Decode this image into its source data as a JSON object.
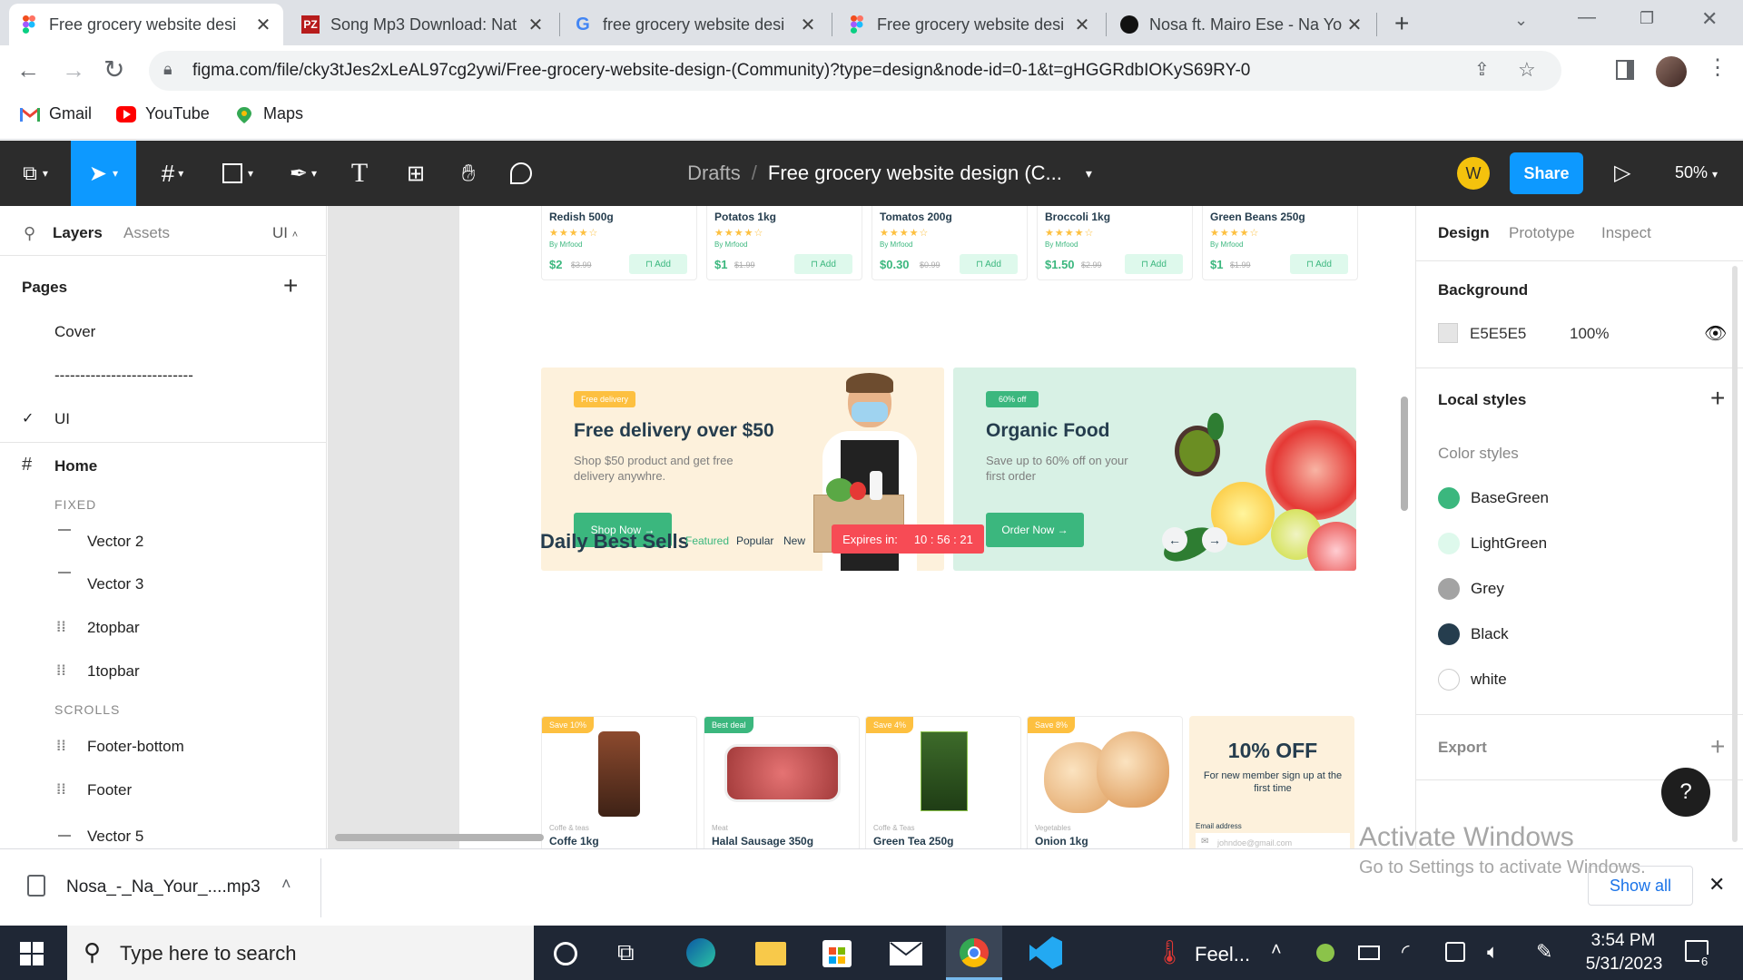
{
  "browser": {
    "tabs": [
      {
        "title": "Free grocery website desi",
        "icon": "figma-icon",
        "active": true
      },
      {
        "title": "Song Mp3 Download: Nat",
        "icon": "pz-icon"
      },
      {
        "title": "free grocery website desi",
        "icon": "google-icon"
      },
      {
        "title": "Free grocery website desi",
        "icon": "figma-icon"
      },
      {
        "title": "Nosa ft. Mairo Ese - Na Yo",
        "icon": "music-icon"
      }
    ],
    "url": "figma.com/file/cky3tJes2xLeAL97cg2ywi/Free-grocery-website-design-(Community)?type=design&node-id=0-1&t=gHGGRdbIOKyS69RY-0",
    "bookmarks": [
      "Gmail",
      "YouTube",
      "Maps"
    ]
  },
  "figma": {
    "breadcrumb_drafts": "Drafts",
    "breadcrumb_sep": "/",
    "file_title": "Free grocery website design (C...",
    "avatar_letter": "W",
    "share_label": "Share",
    "zoom": "50%",
    "left_tabs": [
      "Layers",
      "Assets"
    ],
    "page_selector": "UI",
    "pages_heading": "Pages",
    "pages": [
      "Cover",
      "---------------------------",
      "UI"
    ],
    "frame_name": "Home",
    "section_fixed": "FIXED",
    "fixed_layers": [
      "Vector 2",
      "Vector 3",
      "2topbar",
      "1topbar"
    ],
    "section_scrolls": "SCROLLS",
    "scroll_layers": [
      "Footer-bottom",
      "Footer",
      "Vector 5"
    ],
    "right_tabs": [
      "Design",
      "Prototype",
      "Inspect"
    ],
    "background_heading": "Background",
    "background_hex": "E5E5E5",
    "background_opacity": "100%",
    "local_styles": "Local styles",
    "color_styles_heading": "Color styles",
    "color_styles": [
      {
        "name": "BaseGreen",
        "color": "#3bb77e"
      },
      {
        "name": "LightGreen",
        "color": "#def9ec"
      },
      {
        "name": "Grey",
        "color": "#a3a3a3"
      },
      {
        "name": "Black",
        "color": "#253d4e"
      },
      {
        "name": "white",
        "color": "#ffffff"
      }
    ],
    "export_heading": "Export",
    "help": "?"
  },
  "design": {
    "top_products": [
      {
        "name": "Redish 500g",
        "price": "$2",
        "old": "$3.99"
      },
      {
        "name": "Potatos 1kg",
        "price": "$1",
        "old": "$1.99"
      },
      {
        "name": "Tomatos 200g",
        "price": "$0.30",
        "old": "$0.99"
      },
      {
        "name": "Broccoli 1kg",
        "price": "$1.50",
        "old": "$2.99"
      },
      {
        "name": "Green Beans 250g",
        "price": "$1",
        "old": "$1.99"
      }
    ],
    "stars": "★★★★☆",
    "rating": "(4)",
    "by": "By Mrfood",
    "add": "⊓ Add",
    "banner1": {
      "tag": "Free delivery",
      "title": "Free delivery over $50",
      "text": "Shop $50 product and get free delivery anywhre.",
      "button": "Shop Now →"
    },
    "banner2": {
      "tag": "60% off",
      "title": "Organic Food",
      "text": "Save up to 60% off on your first order",
      "button": "Order Now →"
    },
    "daily_title": "Daily Best Sells",
    "daily_tabs": [
      "Featured",
      "Popular",
      "New"
    ],
    "expires_label": "Expires in:",
    "expires_time": "10 : 56 : 21",
    "daily_products": [
      {
        "tag": "Save 10%",
        "tagcolor": "#fdc040",
        "cat": "Coffe & teas",
        "name": "Coffe 1kg"
      },
      {
        "tag": "Best deal",
        "tagcolor": "#3bb77e",
        "cat": "Meat",
        "name": "Halal Sausage 350g"
      },
      {
        "tag": "Save 4%",
        "tagcolor": "#fdc040",
        "cat": "Coffe & Teas",
        "name": "Green Tea 250g"
      },
      {
        "tag": "Save 8%",
        "tagcolor": "#fdc040",
        "cat": "Vegetables",
        "name": "Onion 1kg"
      }
    ],
    "promo": {
      "title": "10% OFF",
      "text": "For new member sign up at the first time",
      "email_label": "Email address",
      "email_placeholder": "johndoe@gmail.com"
    }
  },
  "download": {
    "file": "Nosa_-_Na_Your_....mp3",
    "show_all": "Show all"
  },
  "watermark": {
    "title": "Activate Windows",
    "sub": "Go to Settings to activate Windows."
  },
  "taskbar": {
    "search_placeholder": "Type here to search",
    "weather": "Feel...",
    "time": "3:54 PM",
    "date": "5/31/2023",
    "notif_count": "6"
  }
}
